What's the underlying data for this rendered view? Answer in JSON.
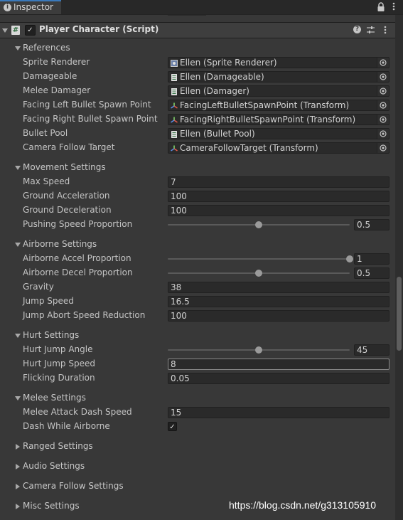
{
  "tab": {
    "label": "Inspector",
    "icon": "info-icon"
  },
  "colors": {
    "background": "#383838",
    "field": "#2a2a2a",
    "tab_accent": "#3a79bb"
  },
  "component": {
    "title": "Player Character (Script)",
    "enabled": true
  },
  "sections": {
    "references": {
      "label": "References",
      "rows": [
        {
          "label": "Sprite Renderer",
          "value": "Ellen (Sprite Renderer)",
          "icon": "sprite-renderer-icon"
        },
        {
          "label": "Damageable",
          "value": "Ellen (Damageable)",
          "icon": "script-icon"
        },
        {
          "label": "Melee Damager",
          "value": "Ellen (Damager)",
          "icon": "script-icon"
        },
        {
          "label": "Facing Left Bullet Spawn Point",
          "value": "FacingLeftBulletSpawnPoint (Transform)",
          "icon": "transform-icon"
        },
        {
          "label": "Facing Right Bullet Spawn Point",
          "value": "FacingRightBulletSpawnPoint (Transform)",
          "icon": "transform-icon"
        },
        {
          "label": "Bullet Pool",
          "value": "Ellen (Bullet Pool)",
          "icon": "script-icon"
        },
        {
          "label": "Camera Follow Target",
          "value": "CameraFollowTarget (Transform)",
          "icon": "transform-icon"
        }
      ]
    },
    "movement": {
      "label": "Movement Settings",
      "max_speed": {
        "label": "Max Speed",
        "value": "7"
      },
      "ground_acceleration": {
        "label": "Ground Acceleration",
        "value": "100"
      },
      "ground_deceleration": {
        "label": "Ground Deceleration",
        "value": "100"
      },
      "pushing_speed": {
        "label": "Pushing Speed Proportion",
        "value": "0.5",
        "level": 0.5
      }
    },
    "airborne": {
      "label": "Airborne Settings",
      "accel": {
        "label": "Airborne Accel Proportion",
        "value": "1",
        "level": 1
      },
      "decel": {
        "label": "Airborne Decel Proportion",
        "value": "0.5",
        "level": 0.5
      },
      "gravity": {
        "label": "Gravity",
        "value": "38"
      },
      "jump_speed": {
        "label": "Jump Speed",
        "value": "16.5"
      },
      "jump_abort": {
        "label": "Jump Abort Speed Reduction",
        "value": "100"
      }
    },
    "hurt": {
      "label": "Hurt Settings",
      "angle": {
        "label": "Hurt Jump Angle",
        "value": "45",
        "level": 0.5
      },
      "speed": {
        "label": "Hurt Jump Speed",
        "value": "8"
      },
      "flicking": {
        "label": "Flicking Duration",
        "value": "0.05"
      }
    },
    "melee": {
      "label": "Melee Settings",
      "dash_speed": {
        "label": "Melee Attack Dash Speed",
        "value": "15"
      },
      "dash_airborne": {
        "label": "Dash While Airborne",
        "checked": true
      }
    },
    "ranged": {
      "label": "Ranged Settings"
    },
    "audio": {
      "label": "Audio Settings"
    },
    "camera": {
      "label": "Camera Follow Settings"
    },
    "misc": {
      "label": "Misc Settings"
    }
  },
  "watermark": "https://blog.csdn.net/g313105910"
}
